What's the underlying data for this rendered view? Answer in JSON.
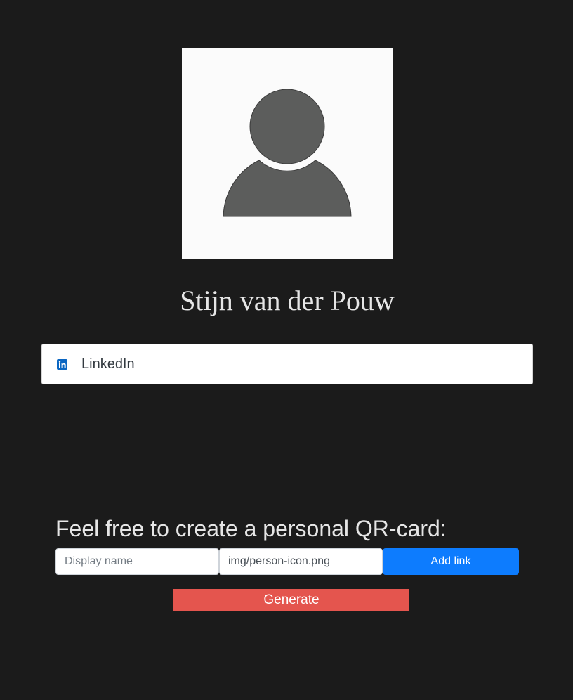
{
  "profile": {
    "avatar_icon": "person-silhouette-icon",
    "name": "Stijn van der Pouw"
  },
  "links": [
    {
      "icon": "linkedin-icon",
      "label": "LinkedIn"
    }
  ],
  "creator": {
    "heading": "Feel free to create a personal QR-card:",
    "display_name_placeholder": "Display name",
    "icon_path_value": "img/person-icon.png",
    "add_link_label": "Add link",
    "generate_label": "Generate"
  },
  "colors": {
    "page_background": "#1b1b1b",
    "add_link_button": "#0d7cfe",
    "generate_button": "#e4554e",
    "linkedin_brand": "#0a66c2"
  }
}
